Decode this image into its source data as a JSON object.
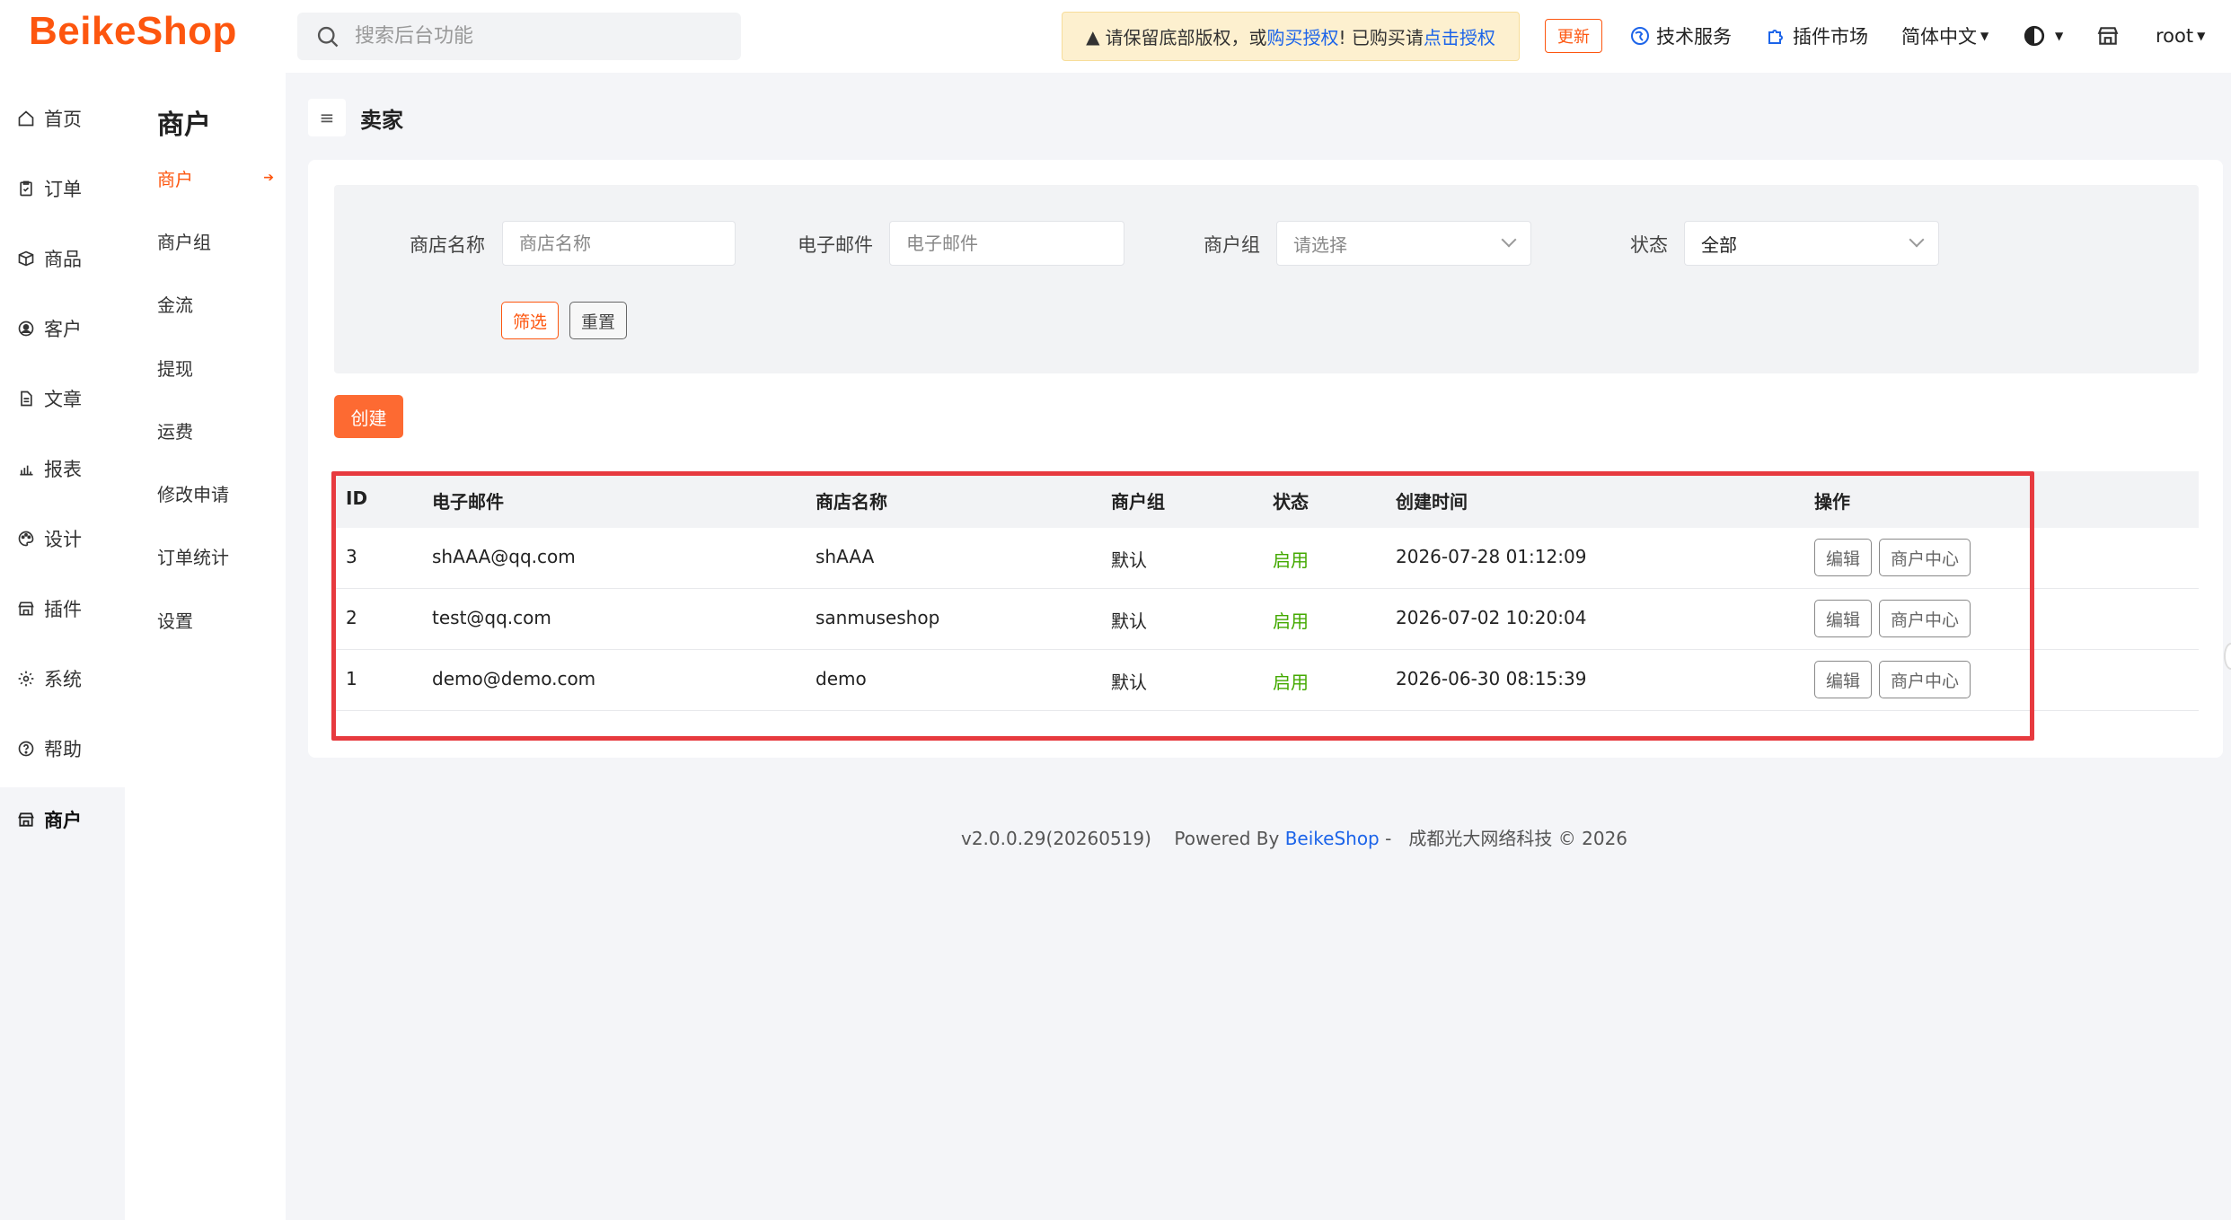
{
  "header": {
    "logo": "BeikeShop",
    "search_placeholder": "搜索后台功能",
    "notice": {
      "text_1": "请保留底部版权，或",
      "link_1": "购买授权",
      "text_2": "! 已购买请",
      "link_2": "点击授权"
    },
    "update_label": "更新",
    "tech_service": "技术服务",
    "plugin_market": "插件市场",
    "language": "简体中文",
    "user": "root"
  },
  "sidebar": {
    "items": [
      {
        "label": "首页",
        "icon": "home-icon"
      },
      {
        "label": "订单",
        "icon": "clipboard-icon"
      },
      {
        "label": "商品",
        "icon": "box-icon"
      },
      {
        "label": "客户",
        "icon": "user-circle-icon"
      },
      {
        "label": "文章",
        "icon": "file-icon"
      },
      {
        "label": "报表",
        "icon": "bar-chart-icon"
      },
      {
        "label": "设计",
        "icon": "palette-icon"
      },
      {
        "label": "插件",
        "icon": "store-icon"
      },
      {
        "label": "系统",
        "icon": "gear-icon"
      },
      {
        "label": "帮助",
        "icon": "help-icon"
      },
      {
        "label": "商户",
        "icon": "merchant-icon"
      }
    ],
    "active": "商户"
  },
  "submenu": {
    "title": "商户",
    "items": [
      {
        "label": "商户"
      },
      {
        "label": "商户组"
      },
      {
        "label": "金流"
      },
      {
        "label": "提现"
      },
      {
        "label": "运费"
      },
      {
        "label": "修改申请"
      },
      {
        "label": "订单统计"
      },
      {
        "label": "设置"
      }
    ],
    "active": "商户"
  },
  "page": {
    "title": "卖家",
    "filter": {
      "store_name_label": "商店名称",
      "store_name_placeholder": "商店名称",
      "email_label": "电子邮件",
      "email_placeholder": "电子邮件",
      "group_label": "商户组",
      "group_value": "请选择",
      "status_label": "状态",
      "status_value": "全部",
      "filter_btn": "筛选",
      "reset_btn": "重置"
    },
    "create_btn": "创建",
    "table": {
      "columns": [
        "ID",
        "电子邮件",
        "商店名称",
        "商户组",
        "状态",
        "创建时间",
        "操作"
      ],
      "rows": [
        {
          "id": "3",
          "email": "shAAA@qq.com",
          "store": "shAAA",
          "group": "默认",
          "status": "启用",
          "created": "2026-07-28 01:12:09",
          "edit": "编辑",
          "center": "商户中心"
        },
        {
          "id": "2",
          "email": "test@qq.com",
          "store": "sanmuseshop",
          "group": "默认",
          "status": "启用",
          "created": "2026-07-02 10:20:04",
          "edit": "编辑",
          "center": "商户中心"
        },
        {
          "id": "1",
          "email": "demo@demo.com",
          "store": "demo",
          "group": "默认",
          "status": "启用",
          "created": "2026-06-30 08:15:39",
          "edit": "编辑",
          "center": "商户中心"
        }
      ]
    }
  },
  "footer": {
    "version": "v2.0.0.29(20260519)",
    "powered": "Powered By",
    "brand": "BeikeShop",
    "company": "成都光大网络科技 © 2026"
  },
  "colors": {
    "brand": "#fd560f",
    "link": "#1c64e9",
    "status_enabled": "#43a900",
    "highlight": "#e73a3f"
  }
}
